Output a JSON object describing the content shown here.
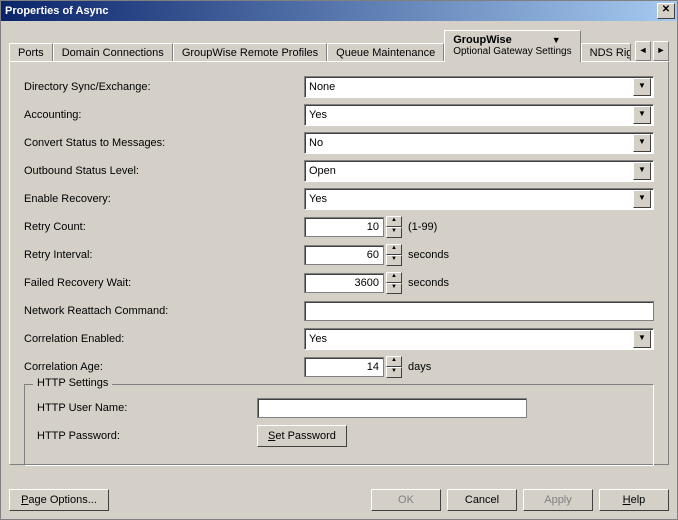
{
  "window": {
    "title": "Properties of Async"
  },
  "tabs": {
    "ports": "Ports",
    "domain_connections": "Domain Connections",
    "groupwise_remote": "GroupWise Remote Profiles",
    "queue_maintenance": "Queue Maintenance",
    "groupwise": "GroupWise",
    "groupwise_sub": "Optional Gateway Settings",
    "nds_rights": "NDS Rights"
  },
  "fields": {
    "directory_sync": {
      "label": "Directory Sync/Exchange:",
      "value": "None"
    },
    "accounting": {
      "label": "Accounting:",
      "value": "Yes"
    },
    "convert_status": {
      "label": "Convert Status to Messages:",
      "value": "No"
    },
    "outbound_status": {
      "label": "Outbound Status Level:",
      "value": "Open"
    },
    "enable_recovery": {
      "label": "Enable Recovery:",
      "value": "Yes"
    },
    "retry_count": {
      "label": "Retry Count:",
      "value": "10",
      "suffix": "(1-99)"
    },
    "retry_interval": {
      "label": "Retry Interval:",
      "value": "60",
      "suffix": "seconds"
    },
    "failed_recovery": {
      "label": "Failed Recovery Wait:",
      "value": "3600",
      "suffix": "seconds"
    },
    "network_reattach": {
      "label": "Network Reattach Command:",
      "value": ""
    },
    "correlation_enabled": {
      "label": "Correlation Enabled:",
      "value": "Yes"
    },
    "correlation_age": {
      "label": "Correlation Age:",
      "value": "14",
      "suffix": "days"
    }
  },
  "httpgroup": {
    "legend": "HTTP Settings",
    "user_label": "HTTP User Name:",
    "user_value": "",
    "password_label": "HTTP Password:",
    "set_password_btn": "Set Password"
  },
  "footer": {
    "page_options": "Page Options...",
    "ok": "OK",
    "cancel": "Cancel",
    "apply": "Apply",
    "help": "Help"
  }
}
